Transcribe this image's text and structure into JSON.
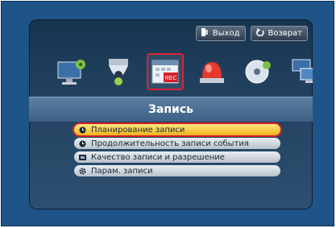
{
  "topbar": {
    "exit_label": "Выход",
    "back_label": "Возврат"
  },
  "toolbar": {
    "icons": [
      {
        "name": "monitor-settings-icon"
      },
      {
        "name": "camera-dome-icon"
      },
      {
        "name": "record-calendar-icon",
        "badge": "REC",
        "selected": true
      },
      {
        "name": "alarm-icon"
      },
      {
        "name": "disc-backup-icon"
      },
      {
        "name": "network-icon"
      }
    ]
  },
  "section_title": "Запись",
  "menu": {
    "items": [
      {
        "label": "Планирование записи",
        "icon": "clock-icon",
        "selected": true
      },
      {
        "label": "Продолжительность записи события",
        "icon": "clock-icon"
      },
      {
        "label": "Качество записи и разрешение",
        "icon": "quality-icon"
      },
      {
        "label": "Парам. записи",
        "icon": "gear-icon"
      }
    ]
  },
  "colors": {
    "selection": "#d4202a",
    "highlight": "#f0b41c"
  }
}
